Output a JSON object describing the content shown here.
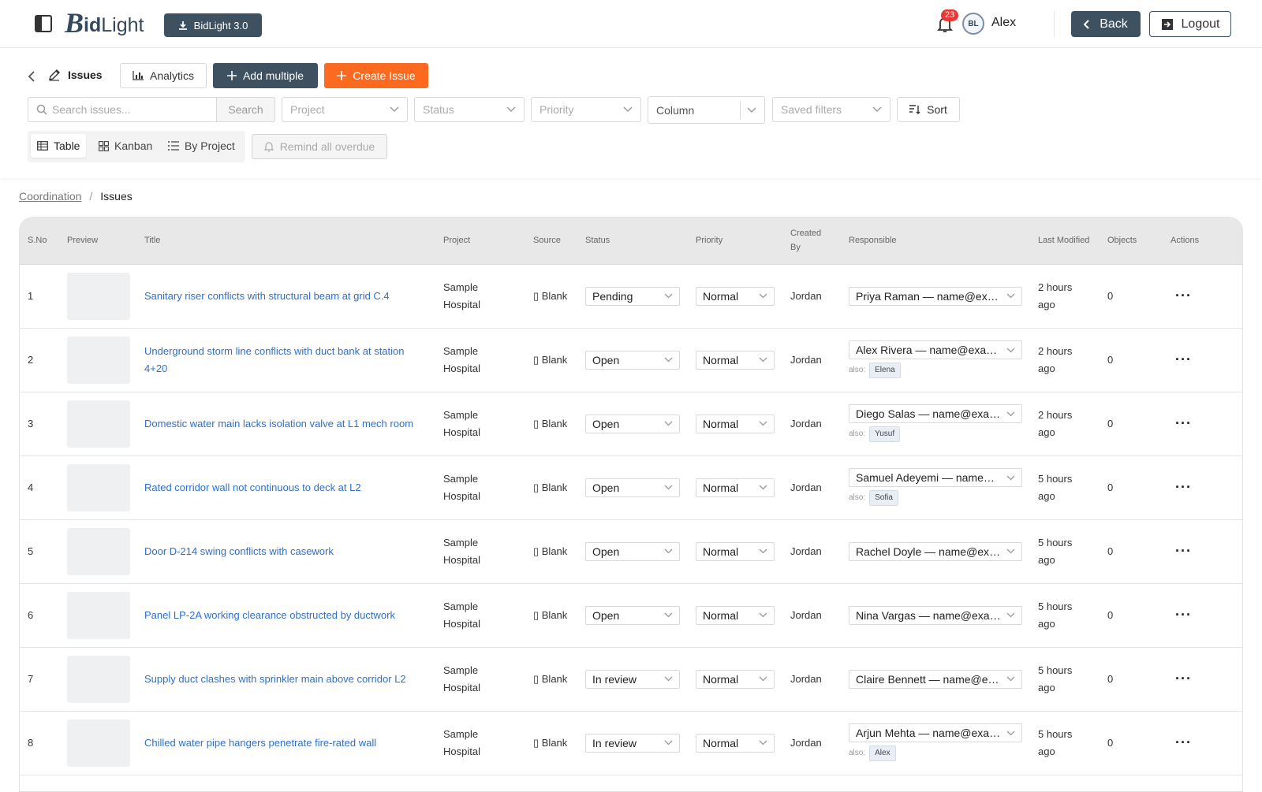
{
  "app": {
    "logo_b": "B",
    "logo_id": "id",
    "logo_light": "Light",
    "version_label": "BidLight 3.0"
  },
  "header": {
    "notifications": "23",
    "avatar_initials": "BL",
    "user": "Alex",
    "back": "Back",
    "logout": "Logout"
  },
  "toolbar": {
    "page_title": "Issues",
    "analytics": "Analytics",
    "add_multiple": "Add multiple",
    "create_issue": "Create Issue",
    "search_placeholder": "Search issues...",
    "search_button": "Search",
    "project_placeholder": "Project",
    "status_placeholder": "Status",
    "priority_placeholder": "Priority",
    "column_label": "Column",
    "saved_filters_placeholder": "Saved filters",
    "sort": "Sort",
    "views": {
      "table": "Table",
      "kanban": "Kanban",
      "by_project": "By Project"
    },
    "remind": "Remind all overdue"
  },
  "breadcrumb": {
    "parent": "Coordination",
    "sep": "/",
    "current": "Issues"
  },
  "table": {
    "columns": {
      "sno": "S.No",
      "preview": "Preview",
      "title": "Title",
      "project": "Project",
      "source": "Source",
      "status": "Status",
      "priority": "Priority",
      "created_line1": "Created",
      "created_line2": "By",
      "responsible": "Responsible",
      "modified": "Last Modified",
      "objects": "Objects",
      "actions": "Actions"
    },
    "also_label": "also:",
    "rows": [
      {
        "sno": "1",
        "title": "Sanitary riser conflicts with structural beam at grid C.4",
        "project_line1": "Sample",
        "project_line2": "Hospital",
        "source": "▯ Blank",
        "status": "Pending",
        "priority": "Normal",
        "created_by": "Jordan",
        "responsible": "Priya Raman — name@example.com",
        "also": "",
        "modified_line1": "2 hours",
        "modified_line2": "ago",
        "objects": "0",
        "actions": "···"
      },
      {
        "sno": "2",
        "title": "Underground storm line conflicts with duct bank at station 4+20",
        "project_line1": "Sample",
        "project_line2": "Hospital",
        "source": "▯ Blank",
        "status": "Open",
        "priority": "Normal",
        "created_by": "Jordan",
        "responsible": "Alex Rivera — name@example.com",
        "also": "Elena",
        "modified_line1": "2 hours",
        "modified_line2": "ago",
        "objects": "0",
        "actions": "···"
      },
      {
        "sno": "3",
        "title": "Domestic water main lacks isolation valve at L1 mech room",
        "project_line1": "Sample",
        "project_line2": "Hospital",
        "source": "▯ Blank",
        "status": "Open",
        "priority": "Normal",
        "created_by": "Jordan",
        "responsible": "Diego Salas — name@example.com",
        "also": "Yusuf",
        "modified_line1": "2 hours",
        "modified_line2": "ago",
        "objects": "0",
        "actions": "···"
      },
      {
        "sno": "4",
        "title": "Rated corridor wall not continuous to deck at L2",
        "project_line1": "Sample",
        "project_line2": "Hospital",
        "source": "▯ Blank",
        "status": "Open",
        "priority": "Normal",
        "created_by": "Jordan",
        "responsible": "Samuel Adeyemi — name@example.com",
        "also": "Sofia",
        "modified_line1": "5 hours",
        "modified_line2": "ago",
        "objects": "0",
        "actions": "···"
      },
      {
        "sno": "5",
        "title": "Door D-214 swing conflicts with casework",
        "project_line1": "Sample",
        "project_line2": "Hospital",
        "source": "▯ Blank",
        "status": "Open",
        "priority": "Normal",
        "created_by": "Jordan",
        "responsible": "Rachel Doyle — name@example.com",
        "also": "",
        "modified_line1": "5 hours",
        "modified_line2": "ago",
        "objects": "0",
        "actions": "···"
      },
      {
        "sno": "6",
        "title": "Panel LP-2A working clearance obstructed by ductwork",
        "project_line1": "Sample",
        "project_line2": "Hospital",
        "source": "▯ Blank",
        "status": "Open",
        "priority": "Normal",
        "created_by": "Jordan",
        "responsible": "Nina Vargas — name@example.com",
        "also": "",
        "modified_line1": "5 hours",
        "modified_line2": "ago",
        "objects": "0",
        "actions": "···"
      },
      {
        "sno": "7",
        "title": "Supply duct clashes with sprinkler main above corridor L2",
        "project_line1": "Sample",
        "project_line2": "Hospital",
        "source": "▯ Blank",
        "status": "In review",
        "priority": "Normal",
        "created_by": "Jordan",
        "responsible": "Claire Bennett — name@example.com",
        "also": "",
        "modified_line1": "5 hours",
        "modified_line2": "ago",
        "objects": "0",
        "actions": "···"
      },
      {
        "sno": "8",
        "title": "Chilled water pipe hangers penetrate fire-rated wall",
        "project_line1": "Sample",
        "project_line2": "Hospital",
        "source": "▯ Blank",
        "status": "In review",
        "priority": "Normal",
        "created_by": "Jordan",
        "responsible": "Arjun Mehta — name@example.com",
        "also": "Alex",
        "modified_line1": "5 hours",
        "modified_line2": "ago",
        "objects": "0",
        "actions": "···"
      }
    ]
  },
  "colors": {
    "primary": "#3d5160",
    "accent": "#fb6a1f",
    "link": "#2e6fd0",
    "badge": "#e53935"
  }
}
